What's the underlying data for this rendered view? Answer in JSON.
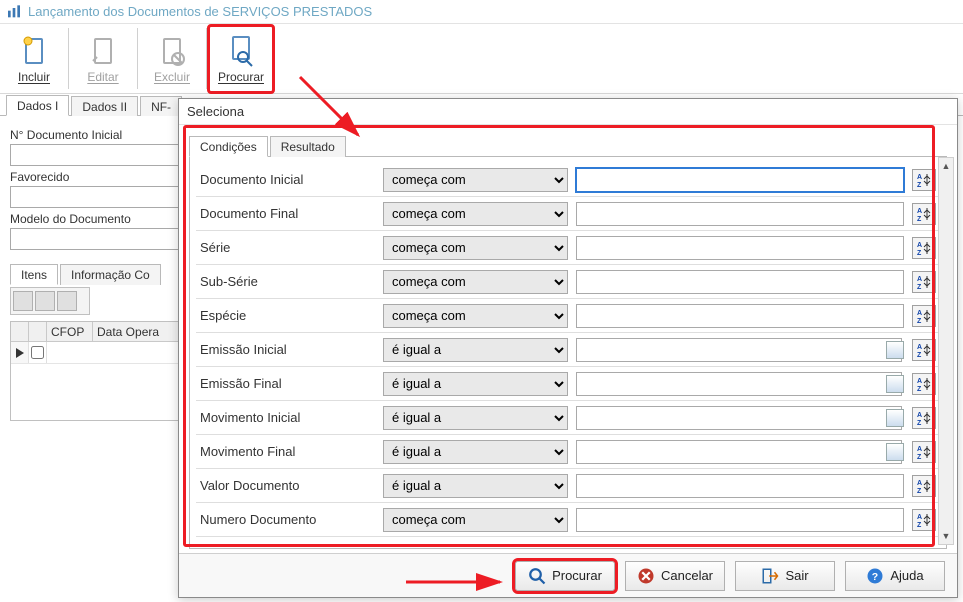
{
  "window": {
    "title": "Lançamento dos Documentos de SERVIÇOS PRESTADOS"
  },
  "toolbar": {
    "incluir": "Incluir",
    "editar": "Editar",
    "excluir": "Excluir",
    "procurar": "Procurar"
  },
  "tabs": {
    "dados1": "Dados I",
    "dados2": "Dados II",
    "nf": "NF-"
  },
  "form": {
    "doc_inicial_label": "N° Documento Inicial",
    "favorecido_label": "Favorecido",
    "modelo_label": "Modelo do Documento"
  },
  "subtabs": {
    "itens": "Itens",
    "info": "Informação Co"
  },
  "grid": {
    "col_cfop": "CFOP",
    "col_data": "Data Opera"
  },
  "dialog": {
    "title": "Seleciona",
    "tab_cond": "Condições",
    "tab_result": "Resultado",
    "rows": [
      {
        "label": "Documento Inicial",
        "op": "começa com",
        "date": false,
        "focused": true
      },
      {
        "label": "Documento Final",
        "op": "começa com",
        "date": false
      },
      {
        "label": "Série",
        "op": "começa com",
        "date": false
      },
      {
        "label": "Sub-Série",
        "op": "começa com",
        "date": false
      },
      {
        "label": "Espécie",
        "op": "começa com",
        "date": false
      },
      {
        "label": "Emissão Inicial",
        "op": "é igual a",
        "date": true
      },
      {
        "label": "Emissão Final",
        "op": "é igual a",
        "date": true
      },
      {
        "label": "Movimento Inicial",
        "op": "é igual a",
        "date": true
      },
      {
        "label": "Movimento Final",
        "op": "é igual a",
        "date": true
      },
      {
        "label": "Valor Documento",
        "op": "é igual a",
        "date": false
      },
      {
        "label": "Numero Documento",
        "op": "começa com",
        "date": false
      }
    ],
    "buttons": {
      "procurar": "Procurar",
      "cancelar": "Cancelar",
      "sair": "Sair",
      "ajuda": "Ajuda"
    }
  }
}
